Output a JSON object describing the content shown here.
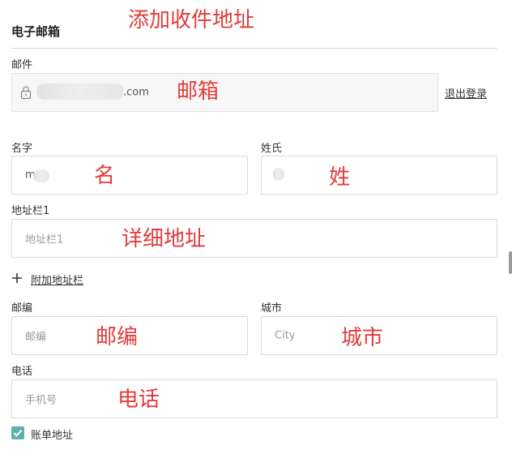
{
  "annotations": {
    "title": "添加收件地址",
    "email": "邮箱",
    "first_name": "名",
    "last_name": "姓",
    "address": "详细地址",
    "postcode": "邮编",
    "city": "城市",
    "phone": "电话"
  },
  "section": {
    "title": "电子邮箱"
  },
  "email": {
    "label": "邮件",
    "value_suffix": ".com",
    "logout_label": "退出登录",
    "icon": "lock-icon"
  },
  "first_name": {
    "label": "名字",
    "value": "m"
  },
  "last_name": {
    "label": "姓氏"
  },
  "address1": {
    "label": "地址栏1",
    "placeholder": "地址栏1"
  },
  "add_address_line": {
    "label": "附加地址栏",
    "icon": "plus-icon"
  },
  "postcode": {
    "label": "邮编",
    "placeholder": "邮编"
  },
  "city": {
    "label": "城市",
    "placeholder": "City"
  },
  "phone": {
    "label": "电话",
    "placeholder": "手机号"
  },
  "billing": {
    "label": "账单地址",
    "checked": true,
    "check_color": "#5fb3a6"
  },
  "colors": {
    "annotation": "#e23b3b"
  }
}
